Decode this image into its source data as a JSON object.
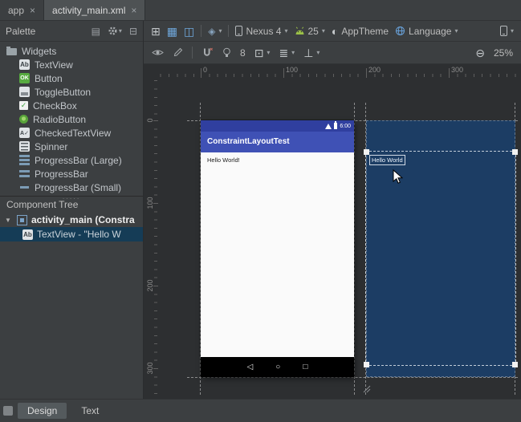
{
  "window_tabs": [
    {
      "label": "app"
    },
    {
      "label": "activity_main.xml"
    }
  ],
  "palette": {
    "title": "Palette",
    "group_label": "Widgets",
    "items": [
      "TextView",
      "Button",
      "ToggleButton",
      "CheckBox",
      "RadioButton",
      "CheckedTextView",
      "Spinner",
      "ProgressBar (Large)",
      "ProgressBar",
      "ProgressBar (Small)"
    ]
  },
  "component_tree": {
    "title": "Component Tree",
    "root_label": "activity_main (Constra",
    "child_label": "TextView - \"Hello W"
  },
  "design_toolbar": {
    "device": "Nexus 4",
    "api_level": "25",
    "theme": "AppTheme",
    "language": "Language",
    "default_margin": "8",
    "zoom_level": "25%"
  },
  "canvas": {
    "rulers": {
      "horizontal": [
        "0",
        "100",
        "200",
        "300"
      ],
      "vertical": [
        "0",
        "100",
        "200",
        "300"
      ]
    },
    "device_screen": {
      "status_time": "6:00",
      "app_bar_title": "ConstraintLayoutTest",
      "body_text": "Hello World!"
    },
    "blueprint": {
      "selected_text": "Hello World"
    }
  },
  "bottom_tabs": {
    "design": "Design",
    "text": "Text"
  },
  "icons": {
    "close": "×",
    "dropdown": "▾",
    "expanded": "▼",
    "panel_view": "▤",
    "hide": "⊟",
    "design_mode": "⊞",
    "blueprint_mode": "▦",
    "both_mode": "◫",
    "orientation": "◈",
    "theme": "◐",
    "margins": "⊡",
    "align": "≣",
    "guidelines": "⊥",
    "zoom_out": "⊖",
    "nav_back": "◁",
    "nav_home": "○",
    "nav_recents": "□",
    "splitter": "∙∙∙∙∙",
    "textview_badge": "Ab",
    "button_badge": "OK",
    "checkedtextview_badge": "A✓",
    "checkbox_check": "✓"
  },
  "colors": {
    "app_bar": "#3f51b5",
    "status_bar": "#303f9f",
    "blueprint_background": "#1c3d64",
    "android_green": "#9bc148",
    "tree_selection": "#153c56"
  }
}
